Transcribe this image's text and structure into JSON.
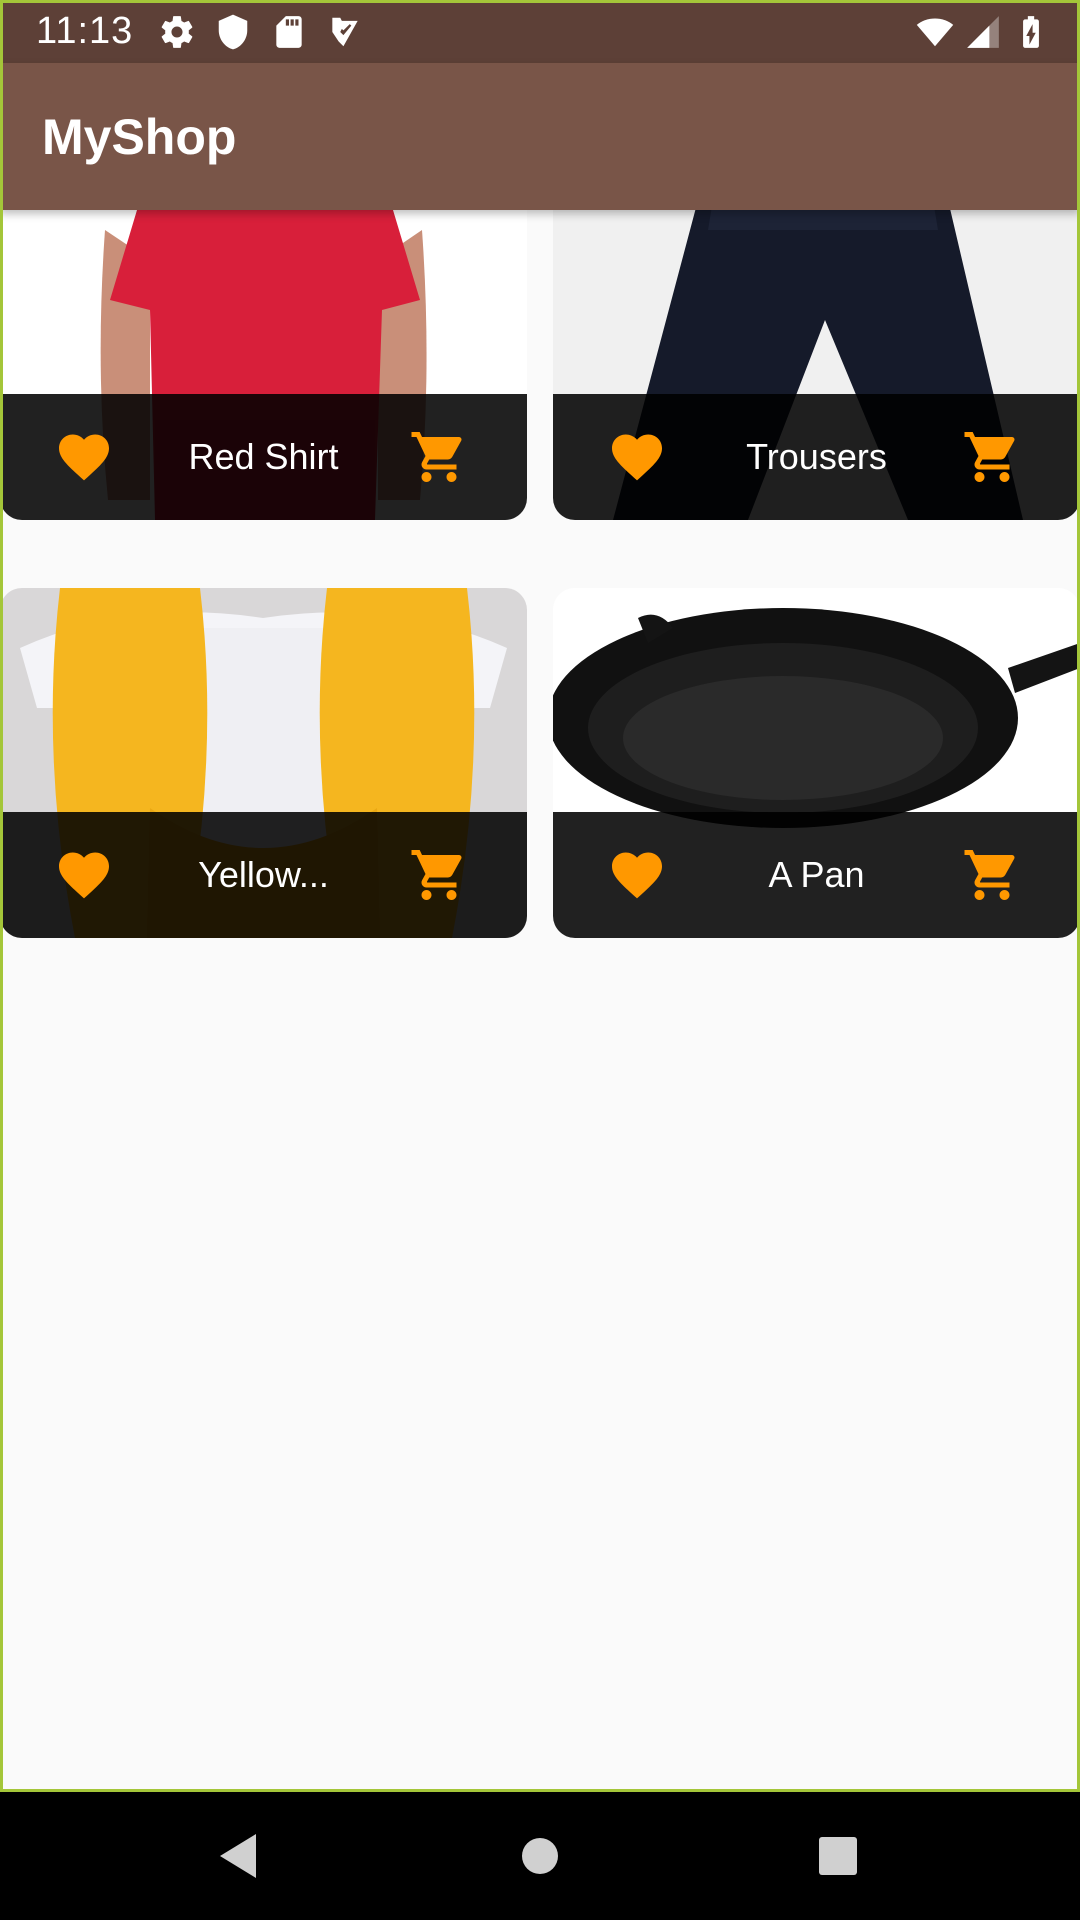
{
  "status_bar": {
    "time": "11:13",
    "left_icons": [
      "settings-icon",
      "shield-icon",
      "sd-card-icon",
      "clipboard-check-icon"
    ],
    "right_icons": [
      "wifi-icon",
      "signal-icon",
      "battery-charging-icon"
    ]
  },
  "app_bar": {
    "title": "MyShop"
  },
  "products": [
    {
      "title": "Red Shirt",
      "favorite_icon": "heart-icon",
      "cart_icon": "cart-icon"
    },
    {
      "title": "Trousers",
      "favorite_icon": "heart-icon",
      "cart_icon": "cart-icon"
    },
    {
      "title": "Yellow...",
      "favorite_icon": "heart-icon",
      "cart_icon": "cart-icon"
    },
    {
      "title": "A Pan",
      "favorite_icon": "heart-icon",
      "cart_icon": "cart-icon"
    }
  ],
  "colors": {
    "status_bar": "#5d4037",
    "app_bar": "#795548",
    "accent": "#ff9800",
    "background": "#fafafa"
  },
  "nav_bar": {
    "buttons": [
      "back-icon",
      "home-icon",
      "recents-icon"
    ]
  }
}
